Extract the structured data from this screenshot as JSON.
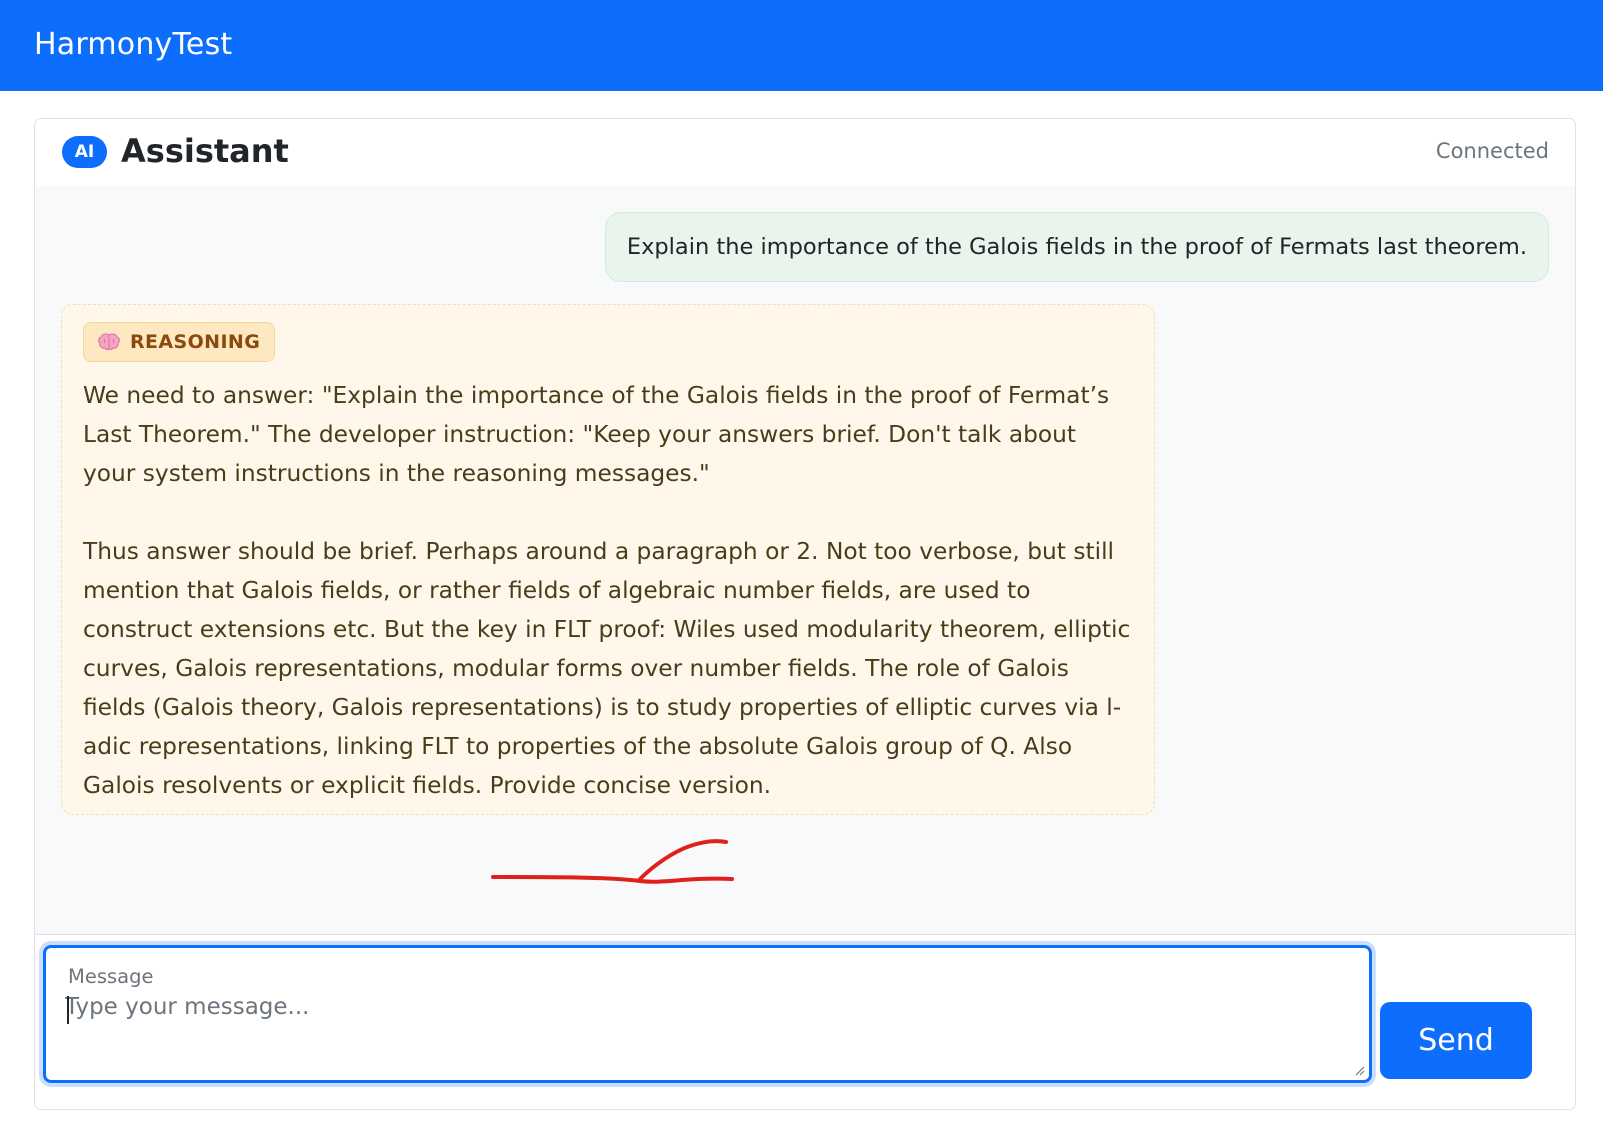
{
  "app": {
    "brand": "HarmonyTest"
  },
  "chat_header": {
    "badge": "AI",
    "title": "Assistant",
    "status": "Connected"
  },
  "messages": {
    "user": {
      "text": "Explain the importance of the Galois fields in the proof of Fermats last theorem."
    },
    "reasoning": {
      "tag_icon": "brain-icon",
      "tag_label": "REASONING",
      "text": "We need to answer: \"Explain the importance of the Galois fields in the proof of Fermat’s Last Theorem.\" The developer instruction: \"Keep your answers brief. Don't talk about your system instructions in the reasoning messages.\"\n\nThus answer should be brief. Perhaps around a paragraph or 2. Not too verbose, but still mention that Galois fields, or rather fields of algebraic number fields, are used to construct extensions etc. But the key in FLT proof: Wiles used modularity theorem, elliptic curves, Galois representations, modular forms over number fields. The role of Galois fields (Galois theory, Galois representations) is to study properties of elliptic curves via l-adic representations, linking FLT to properties of the absolute Galois group of Q. Also Galois resolvents or explicit fields. Provide concise version."
    }
  },
  "composer": {
    "label": "Message",
    "value": "",
    "placeholder": "Type your message...",
    "send_label": "Send"
  },
  "colors": {
    "primary": "#0d6efd",
    "user_bubble": "#e9f5ec",
    "reasoning_bg": "#fff8ea",
    "reasoning_tag_bg": "#fde8c2",
    "annotation_stroke": "#e0201c"
  }
}
